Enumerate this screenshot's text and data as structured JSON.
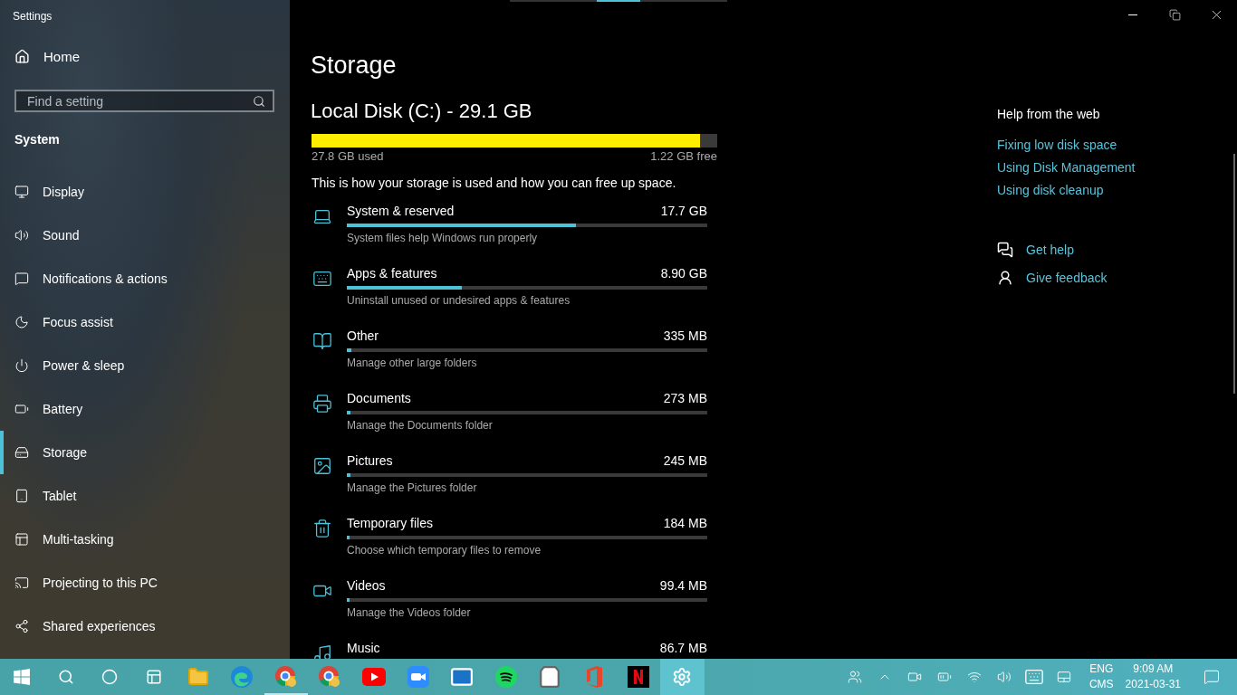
{
  "window": {
    "title": "Settings"
  },
  "sidebar": {
    "home": "Home",
    "search": {
      "placeholder": "Find a setting"
    },
    "section": "System",
    "items": [
      {
        "kind": "display",
        "label": "Display",
        "selected": false
      },
      {
        "kind": "sound",
        "label": "Sound",
        "selected": false
      },
      {
        "kind": "notifications",
        "label": "Notifications & actions",
        "selected": false
      },
      {
        "kind": "focus",
        "label": "Focus assist",
        "selected": false
      },
      {
        "kind": "power",
        "label": "Power & sleep",
        "selected": false
      },
      {
        "kind": "battery",
        "label": "Battery",
        "selected": false
      },
      {
        "kind": "storage",
        "label": "Storage",
        "selected": true
      },
      {
        "kind": "tablet",
        "label": "Tablet",
        "selected": false
      },
      {
        "kind": "multitasking",
        "label": "Multi-tasking",
        "selected": false
      },
      {
        "kind": "projecting",
        "label": "Projecting to this PC",
        "selected": false
      },
      {
        "kind": "shared",
        "label": "Shared experiences",
        "selected": false
      }
    ]
  },
  "main": {
    "title": "Storage",
    "disk": {
      "name": "Local Disk (C:) - 29.1 GB",
      "level": 0.958,
      "used": "27.8 GB used",
      "free": "1.22 GB free"
    },
    "intro": "This is how your storage is used and how you can free up space.",
    "categories": [
      {
        "kind": "system",
        "name": "System & reserved",
        "size": "17.7 GB",
        "level": 0.636,
        "description": "System files help Windows run properly"
      },
      {
        "kind": "apps",
        "name": "Apps & features",
        "size": "8.90 GB",
        "level": 0.32,
        "description": "Uninstall unused or undesired apps & features"
      },
      {
        "kind": "other",
        "name": "Other",
        "size": "335 MB",
        "level": 0.012,
        "description": "Manage other large folders"
      },
      {
        "kind": "documents",
        "name": "Documents",
        "size": "273 MB",
        "level": 0.01,
        "description": "Manage the Documents folder"
      },
      {
        "kind": "pictures",
        "name": "Pictures",
        "size": "245 MB",
        "level": 0.009,
        "description": "Manage the Pictures folder"
      },
      {
        "kind": "temporary",
        "name": "Temporary files",
        "size": "184 MB",
        "level": 0.007,
        "description": "Choose which temporary files to remove"
      },
      {
        "kind": "videos",
        "name": "Videos",
        "size": "99.4 MB",
        "level": 0.005,
        "description": "Manage the Videos folder"
      },
      {
        "kind": "music",
        "name": "Music",
        "size": "86.7 MB"
      }
    ]
  },
  "help": {
    "title": "Help from the web",
    "links": [
      "Fixing low disk space",
      "Using Disk Management",
      "Using disk cleanup"
    ],
    "actions": [
      {
        "kind": "help",
        "label": "Get help"
      },
      {
        "kind": "feedback",
        "label": "Give feedback"
      }
    ]
  },
  "taskbar": {
    "apps": [
      {
        "kind": "start",
        "selected": false,
        "open": false
      },
      {
        "kind": "search",
        "selected": false,
        "open": false
      },
      {
        "kind": "cortana",
        "selected": false,
        "open": false
      },
      {
        "kind": "taskview",
        "selected": false,
        "open": false
      },
      {
        "kind": "explorer",
        "selected": false,
        "open": false
      },
      {
        "kind": "edge",
        "selected": false,
        "open": false
      },
      {
        "kind": "chrome",
        "selected": false,
        "open": true
      },
      {
        "kind": "chrome",
        "selected": false,
        "open": false
      },
      {
        "kind": "youtube",
        "selected": false,
        "open": false
      },
      {
        "kind": "zoom",
        "selected": false,
        "open": false
      },
      {
        "kind": "mail",
        "selected": false,
        "open": false
      },
      {
        "kind": "spotify",
        "selected": false,
        "open": false
      },
      {
        "kind": "store",
        "selected": false,
        "open": false
      },
      {
        "kind": "office",
        "selected": false,
        "open": false
      },
      {
        "kind": "netflix",
        "selected": false,
        "open": false
      },
      {
        "kind": "settings",
        "selected": true,
        "open": false
      }
    ],
    "tray": [
      {
        "kind": "people"
      },
      {
        "kind": "chevron"
      },
      {
        "kind": "camera"
      },
      {
        "kind": "battery"
      },
      {
        "kind": "wifi"
      },
      {
        "kind": "volume"
      },
      {
        "kind": "keyboard"
      },
      {
        "kind": "touchpad"
      }
    ],
    "input_language": "ENG",
    "input_method": "CMS",
    "time": "9:09 AM",
    "date": "2021-03-31"
  }
}
